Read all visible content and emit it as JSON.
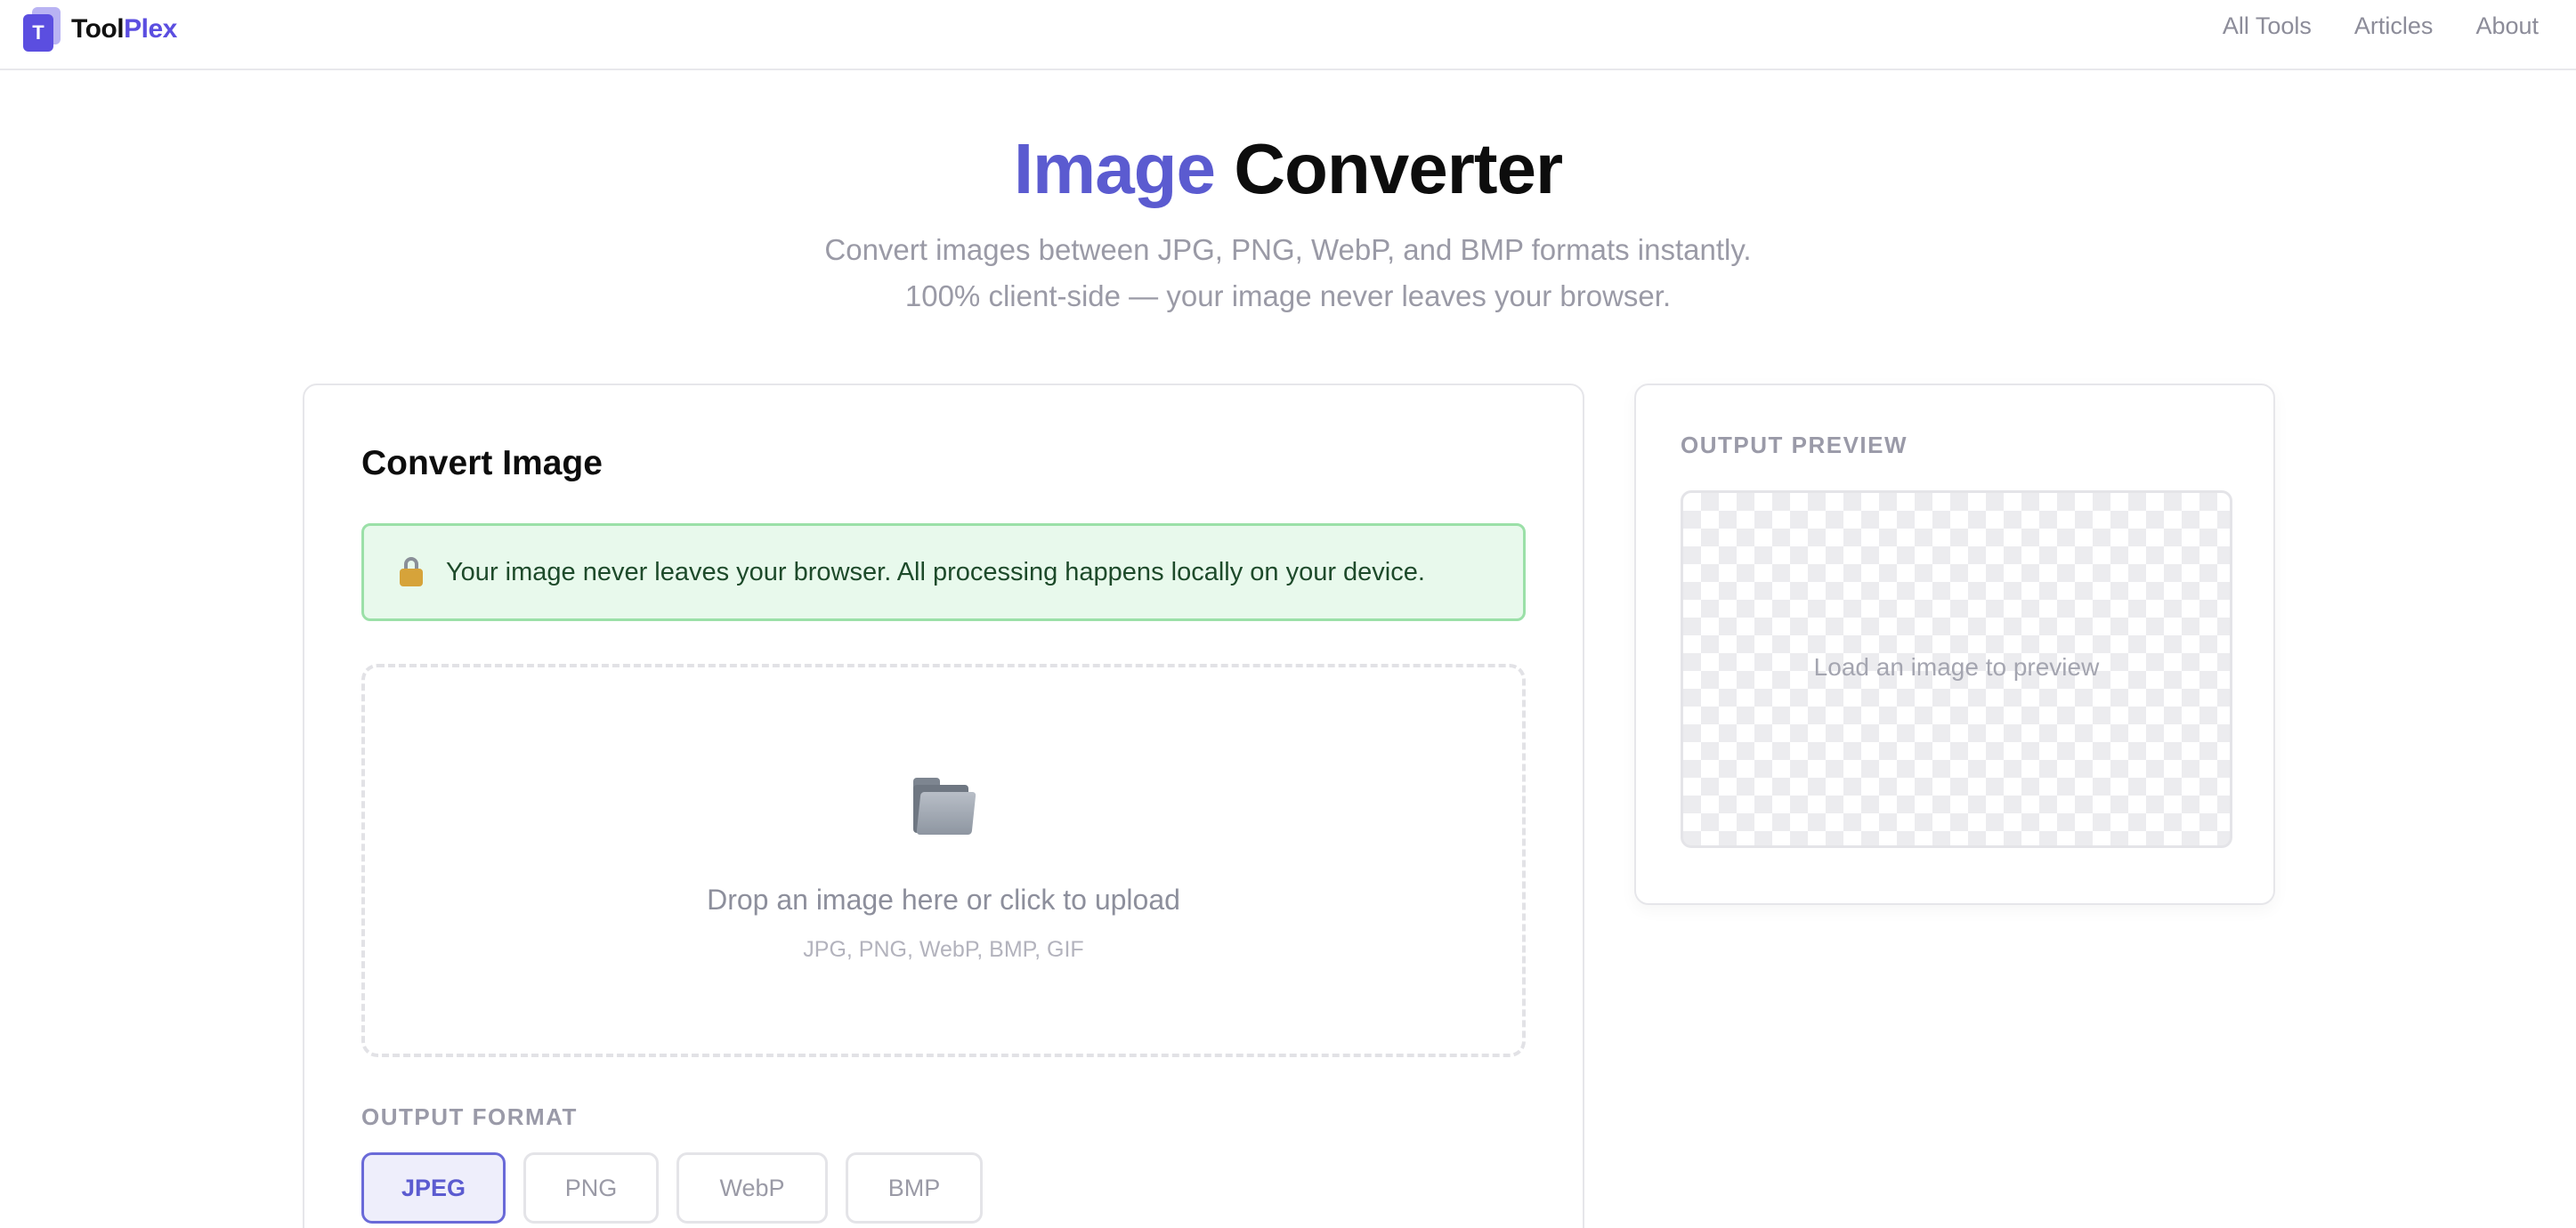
{
  "header": {
    "logo_letter": "T",
    "brand_part1": "Tool",
    "brand_part2": "Plex",
    "nav": [
      "All Tools",
      "Articles",
      "About"
    ]
  },
  "hero": {
    "title_accent": "Image",
    "title_rest": "Converter",
    "subtitle_line1": "Convert images between JPG, PNG, WebP, and BMP formats instantly.",
    "subtitle_line2": "100% client-side — your image never leaves your browser."
  },
  "converter": {
    "title": "Convert Image",
    "notice_icon": "lock-icon",
    "notice": "Your image never leaves your browser. All processing happens locally on your device.",
    "drop_icon": "folder-icon",
    "drop_text": "Drop an image here or click to upload",
    "drop_formats": "JPG, PNG, WebP, BMP, GIF",
    "format_label": "OUTPUT FORMAT",
    "formats": [
      "JPEG",
      "PNG",
      "WebP",
      "BMP"
    ],
    "selected_format": "JPEG"
  },
  "preview": {
    "label": "OUTPUT PREVIEW",
    "placeholder": "Load an image to preview"
  },
  "colors": {
    "accent": "#5b5bd0",
    "brand": "#5b4ee0",
    "notice_bg": "#e8f9ec",
    "notice_border": "#9be0a8"
  }
}
